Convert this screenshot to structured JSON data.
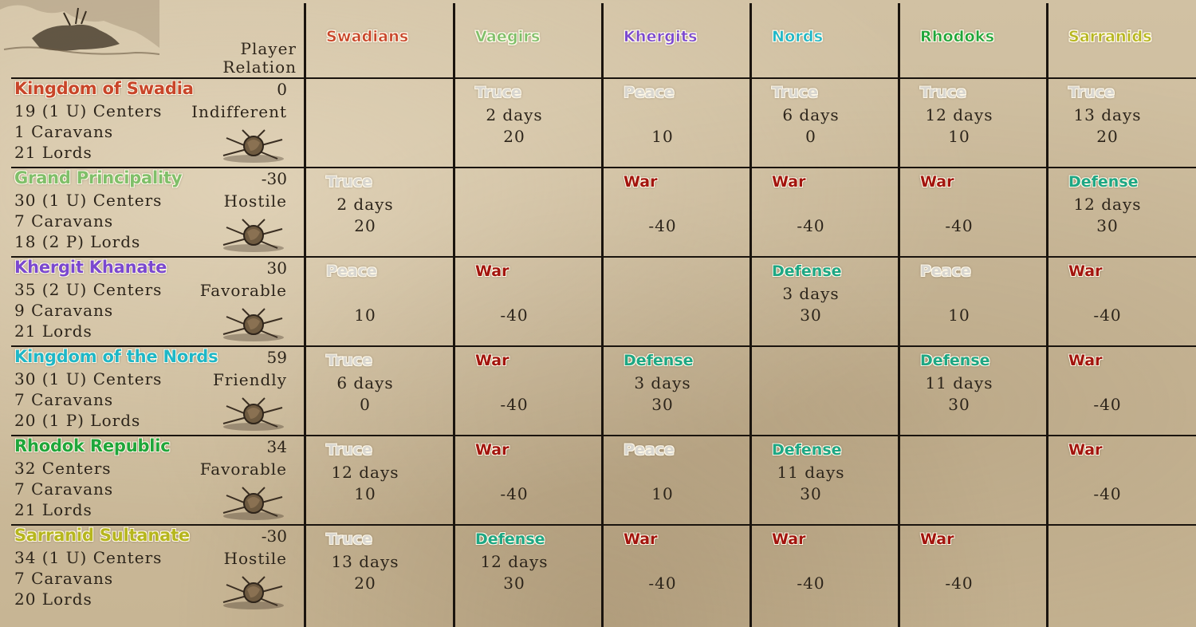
{
  "colors": {
    "swadians": "#c8452a",
    "vaegirs": "#7fbf6a",
    "khergits": "#7a48d0",
    "nords": "#1fb7c8",
    "rhodoks": "#1ea63b",
    "sarranids": "#b6b61e",
    "war": "#a2140e",
    "defense": "#1ea785",
    "truce": "#d8d6d0",
    "peace": "#d8d6d0"
  },
  "corner": {
    "line1": "Player",
    "line2": "Relation"
  },
  "columns": [
    {
      "label": "Swadians",
      "color_key": "swadians"
    },
    {
      "label": "Vaegirs",
      "color_key": "vaegirs"
    },
    {
      "label": "Khergits",
      "color_key": "khergits"
    },
    {
      "label": "Nords",
      "color_key": "nords"
    },
    {
      "label": "Rhodoks",
      "color_key": "rhodoks"
    },
    {
      "label": "Sarranids",
      "color_key": "sarranids"
    }
  ],
  "rows": [
    {
      "name": "Kingdom of Swadia",
      "color_key": "swadians",
      "relation": "0",
      "centers": "19 (1 U) Centers",
      "caravans": "1 Caravans",
      "lords": "21 Lords",
      "status": "Indifferent",
      "icon": "warrior-banner-icon",
      "cells": [
        null,
        {
          "state": "Truce",
          "kind": "truce",
          "days": "2 days",
          "score": "20"
        },
        {
          "state": "Peace",
          "kind": "peace",
          "days": "",
          "score": "10"
        },
        {
          "state": "Truce",
          "kind": "truce",
          "days": "6 days",
          "score": "0"
        },
        {
          "state": "Truce",
          "kind": "truce",
          "days": "12 days",
          "score": "10"
        },
        {
          "state": "Truce",
          "kind": "truce",
          "days": "13 days",
          "score": "20"
        }
      ]
    },
    {
      "name": "Grand Principality",
      "color_key": "vaegirs",
      "relation": "-30",
      "centers": "30 (1 U) Centers",
      "caravans": "7 Caravans",
      "lords": "18 (2 P) Lords",
      "status": "Hostile",
      "icon": "warrior-banner-icon",
      "cells": [
        {
          "state": "Truce",
          "kind": "truce",
          "days": "2 days",
          "score": "20"
        },
        null,
        {
          "state": "War",
          "kind": "war",
          "days": "",
          "score": "-40"
        },
        {
          "state": "War",
          "kind": "war",
          "days": "",
          "score": "-40"
        },
        {
          "state": "War",
          "kind": "war",
          "days": "",
          "score": "-40"
        },
        {
          "state": "Defense",
          "kind": "defense",
          "days": "12 days",
          "score": "30"
        }
      ]
    },
    {
      "name": "Khergit Khanate",
      "color_key": "khergits",
      "relation": "30",
      "centers": "35 (2 U) Centers",
      "caravans": "9 Caravans",
      "lords": "21 Lords",
      "status": "Favorable",
      "icon": "warrior-banner-icon",
      "cells": [
        {
          "state": "Peace",
          "kind": "peace",
          "days": "",
          "score": "10"
        },
        {
          "state": "War",
          "kind": "war",
          "days": "",
          "score": "-40"
        },
        null,
        {
          "state": "Defense",
          "kind": "defense",
          "days": "3 days",
          "score": "30"
        },
        {
          "state": "Peace",
          "kind": "peace",
          "days": "",
          "score": "10"
        },
        {
          "state": "War",
          "kind": "war",
          "days": "",
          "score": "-40"
        }
      ]
    },
    {
      "name": "Kingdom of the Nords",
      "color_key": "nords",
      "relation": "59",
      "centers": "30 (1 U) Centers",
      "caravans": "7 Caravans",
      "lords": "20 (1 P) Lords",
      "status": "Friendly",
      "icon": "warrior-banner-icon",
      "cells": [
        {
          "state": "Truce",
          "kind": "truce",
          "days": "6 days",
          "score": "0"
        },
        {
          "state": "War",
          "kind": "war",
          "days": "",
          "score": "-40"
        },
        {
          "state": "Defense",
          "kind": "defense",
          "days": "3 days",
          "score": "30"
        },
        null,
        {
          "state": "Defense",
          "kind": "defense",
          "days": "11 days",
          "score": "30"
        },
        {
          "state": "War",
          "kind": "war",
          "days": "",
          "score": "-40"
        }
      ]
    },
    {
      "name": "Rhodok Republic",
      "color_key": "rhodoks",
      "relation": "34",
      "centers": "32 Centers",
      "caravans": "7 Caravans",
      "lords": "21 Lords",
      "status": "Favorable",
      "icon": "warrior-banner-icon",
      "cells": [
        {
          "state": "Truce",
          "kind": "truce",
          "days": "12 days",
          "score": "10"
        },
        {
          "state": "War",
          "kind": "war",
          "days": "",
          "score": "-40"
        },
        {
          "state": "Peace",
          "kind": "peace",
          "days": "",
          "score": "10"
        },
        {
          "state": "Defense",
          "kind": "defense",
          "days": "11 days",
          "score": "30"
        },
        null,
        {
          "state": "War",
          "kind": "war",
          "days": "",
          "score": "-40"
        }
      ]
    },
    {
      "name": "Sarranid Sultanate",
      "color_key": "sarranids",
      "relation": "-30",
      "centers": "34 (1 U) Centers",
      "caravans": "7 Caravans",
      "lords": "20 Lords",
      "status": "Hostile",
      "icon": "warrior-banner-icon",
      "cells": [
        {
          "state": "Truce",
          "kind": "truce",
          "days": "13 days",
          "score": "20"
        },
        {
          "state": "Defense",
          "kind": "defense",
          "days": "12 days",
          "score": "30"
        },
        {
          "state": "War",
          "kind": "war",
          "days": "",
          "score": "-40"
        },
        {
          "state": "War",
          "kind": "war",
          "days": "",
          "score": "-40"
        },
        {
          "state": "War",
          "kind": "war",
          "days": "",
          "score": "-40"
        },
        null
      ]
    }
  ]
}
